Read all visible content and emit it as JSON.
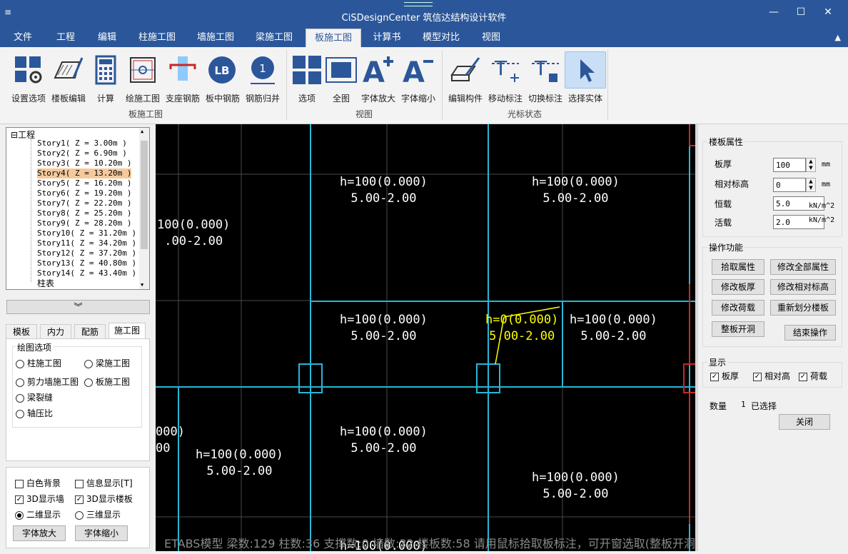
{
  "window": {
    "title": "CiSDesignCenter 筑信达结构设计软件",
    "minimize": "—",
    "maximize": "☐",
    "close": "✕"
  },
  "menu": {
    "tabs": [
      "文件",
      "工程",
      "编辑",
      "柱施工图",
      "墙施工图",
      "梁施工图",
      "板施工图",
      "计算书",
      "模型对比",
      "视图"
    ],
    "active": "板施工图",
    "collapse": "▲"
  },
  "ribbon": {
    "buttons": [
      "设置选项",
      "楼板编辑",
      "计算",
      "绘施工图",
      "支座钢筋",
      "板中钢筋",
      "钢筋归并",
      "选项",
      "全图",
      "字体放大",
      "字体缩小",
      "编辑构件",
      "移动标注",
      "切换标注",
      "选择实体"
    ],
    "groups": [
      "板施工图",
      "视图",
      "光标状态"
    ],
    "selected": "选择实体",
    "accent": "#2b579a"
  },
  "tree": {
    "root": "工程",
    "root_toggle": "⊟",
    "items": [
      "Story1( Z = 3.00m )",
      "Story2( Z = 6.90m )",
      "Story3( Z = 10.20m )",
      "Story4( Z = 13.20m )",
      "Story5( Z = 16.20m )",
      "Story6( Z = 19.20m )",
      "Story7( Z = 22.20m )",
      "Story8( Z = 25.20m )",
      "Story9( Z = 28.20m )",
      "Story10( Z = 31.20m )",
      "Story11( Z = 34.20m )",
      "Story12( Z = 37.20m )",
      "Story13( Z = 40.80m )",
      "Story14( Z = 43.40m )",
      "柱表"
    ],
    "selected": "Story4( Z = 13.20m )",
    "scroll_up": "▲",
    "scroll_down": "▼"
  },
  "expand_icon": "︾",
  "left_tabs": {
    "tabs": [
      "模板",
      "内力",
      "配筋",
      "施工图"
    ],
    "active": "施工图"
  },
  "draw_options": {
    "title": "绘图选项",
    "options": [
      "柱施工图",
      "梁施工图",
      "剪力墙施工图",
      "板施工图",
      "梁裂缝",
      "轴压比"
    ]
  },
  "display_options": {
    "white_bg": "白色背景",
    "info_display": "信息显示[T]",
    "show_wall_3d": "3D显示墙",
    "show_slab_3d": "3D显示楼板",
    "view_2d": "二维显示",
    "view_3d": "三维显示",
    "font_up": "字体放大",
    "font_down": "字体缩小",
    "white_bg_checked": false,
    "info_checked": false,
    "wall_checked": true,
    "slab_checked": true,
    "mode": "二维显示"
  },
  "canvas": {
    "labels": [
      {
        "line1": "h=100(0.000)",
        "line2": "5.00-2.00"
      },
      {
        "line1": "h=100(0.000)",
        "line2": "5.00-2.00"
      },
      {
        "line1": "100(0.000)",
        "line2": ".00-2.00"
      },
      {
        "line1": "h=100(0.000)",
        "line2": "5.00-2.00"
      },
      {
        "line1": "h=0(0.000)",
        "line2": "5.00-2.00"
      },
      {
        "line1": "h=100(0.000)",
        "line2": "5.00-2.00"
      },
      {
        "line1": "000)",
        "line2": "00"
      },
      {
        "line1": "h=100(0.000)",
        "line2": "5.00-2.00"
      },
      {
        "line1": "h=100(0.000)",
        "line2": "5.00-2.00"
      },
      {
        "line1": "h=100(0.000)",
        "line2": "5.00-2.00"
      },
      {
        "line1": "h=100(0.000)",
        "line2": ""
      }
    ],
    "status_left": "ETABS模型  梁数:129 柱数:36 支撑数:0 墙数:32 楼板数:58",
    "status_right": "请用鼠标拾取板标注，可开窗选取(整板开洞)",
    "highlight_color": "#ffff00",
    "beam_color": "#29b6d6"
  },
  "props": {
    "title": "楼板属性",
    "thickness_label": "板厚",
    "thickness_value": "100",
    "thickness_unit": "mm",
    "elev_label": "相对标高",
    "elev_value": "0",
    "elev_unit": "mm",
    "dead_label": "恒载",
    "dead_value": "5.0",
    "dead_unit": "kN/m^2",
    "live_label": "活载",
    "live_value": "2.0",
    "live_unit": "kN/m^2"
  },
  "operations": {
    "title": "操作功能",
    "buttons": [
      "拾取属性",
      "修改全部属性",
      "修改板厚",
      "修改相对标高",
      "修改荷载",
      "重新划分楼板",
      "整板开洞",
      "结束操作"
    ]
  },
  "display": {
    "title": "显示",
    "items": [
      "板厚",
      "相对高",
      "荷载"
    ]
  },
  "selection": {
    "count_label": "数量",
    "count": "1",
    "status": "已选择",
    "close": "关闭"
  }
}
